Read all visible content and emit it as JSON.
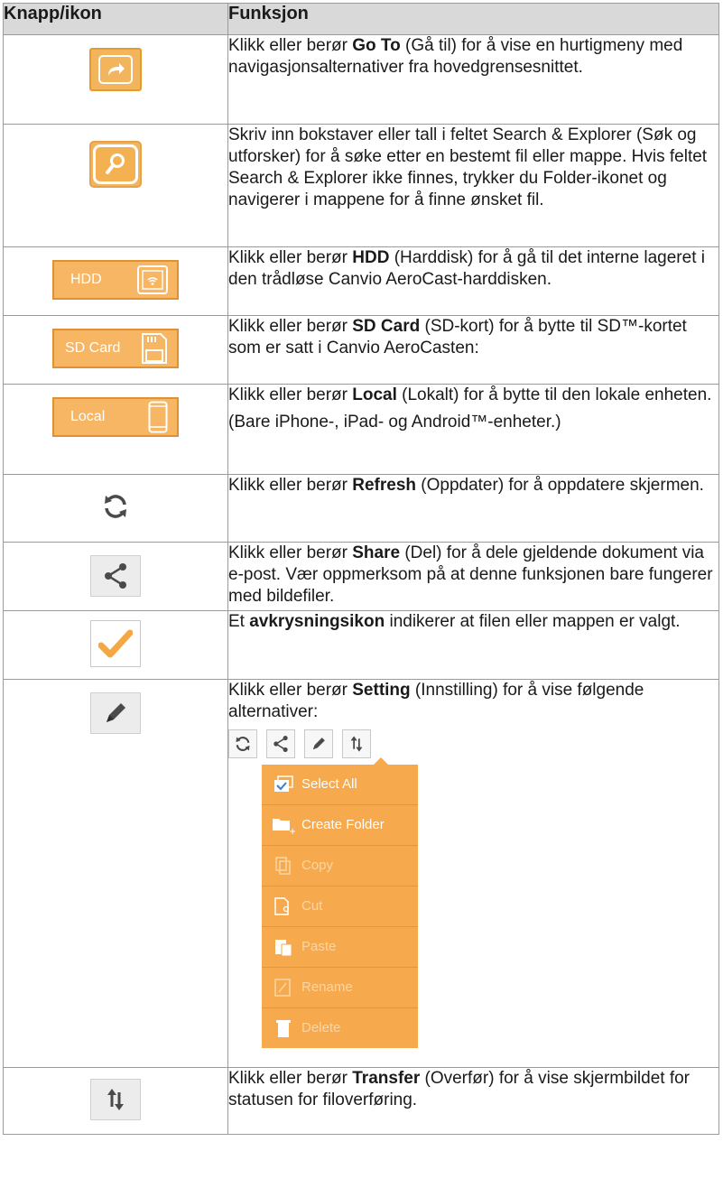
{
  "header": {
    "col1": "Knapp/ikon",
    "col2": "Funksjon"
  },
  "rows": {
    "goto": {
      "t1": "Klikk eller berør ",
      "b1": "Go To",
      "t2": " (Gå til) for å vise en hurtigmeny med navigasjonsalternativer fra hovedgrensesnittet.",
      "icon": "go-to-arrow-icon"
    },
    "search": {
      "t1": "Skriv inn bokstaver eller tall i feltet Search & Explorer (Søk og utforsker) for å søke etter en bestemt fil eller mappe. Hvis feltet Search & Explorer ikke finnes, trykker du Folder-ikonet og navigerer i mappene for å finne ønsket fil.",
      "icon": "magnifier-icon"
    },
    "hdd": {
      "btn": "HDD",
      "t1": "Klikk eller berør ",
      "b1": "HDD",
      "t2": " (Harddisk) for å gå til det interne lageret i den trådløse Canvio AeroCast-harddisken.",
      "icon": "wireless-drive-icon"
    },
    "sd": {
      "btn": "SD Card",
      "t1": "Klikk eller berør ",
      "b1": "SD Card",
      "t2": " (SD-kort) for å bytte til SD™-kortet som er satt i Canvio AeroCasten:",
      "icon": "sd-card-icon"
    },
    "local": {
      "btn": "Local",
      "t1": "Klikk eller berør ",
      "b1": "Local",
      "t2": " (Lokalt) for å bytte til den lokale enheten.",
      "note": "(Bare iPhone-, iPad- og Android™-enheter.)",
      "icon": "phone-icon"
    },
    "refresh": {
      "t1": "Klikk eller berør ",
      "b1": "Refresh",
      "t2": " (Oppdater) for å oppdatere skjermen.",
      "icon": "refresh-icon"
    },
    "share": {
      "t1": "Klikk eller berør ",
      "b1": "Share",
      "t2": " (Del) for å dele gjeldende dokument via e-post. Vær oppmerksom på at denne funksjonen bare fungerer med bildefiler.",
      "icon": "share-icon"
    },
    "check": {
      "t1": "Et ",
      "b1": "avkrysningsikon",
      "t2": " indikerer at filen eller mappen er valgt.",
      "icon": "checkmark-icon"
    },
    "setting": {
      "t1": "Klikk eller berør ",
      "b1": "Setting",
      "t2": " (Innstilling) for å vise følgende alternativer:",
      "icon": "pencil-icon",
      "menu": [
        "Select All",
        "Create Folder",
        "Copy",
        "Cut",
        "Paste",
        "Rename",
        "Delete"
      ]
    },
    "transfer": {
      "t1": "Klikk eller berør ",
      "b1": "Transfer",
      "t2": " (Overfør) for å vise skjermbildet for statusen for filoverføring.",
      "icon": "transfer-arrows-icon"
    }
  },
  "colors": {
    "orange": "#f6a94d",
    "orange_border": "#e09233",
    "header_bg": "#d9d9d9"
  }
}
